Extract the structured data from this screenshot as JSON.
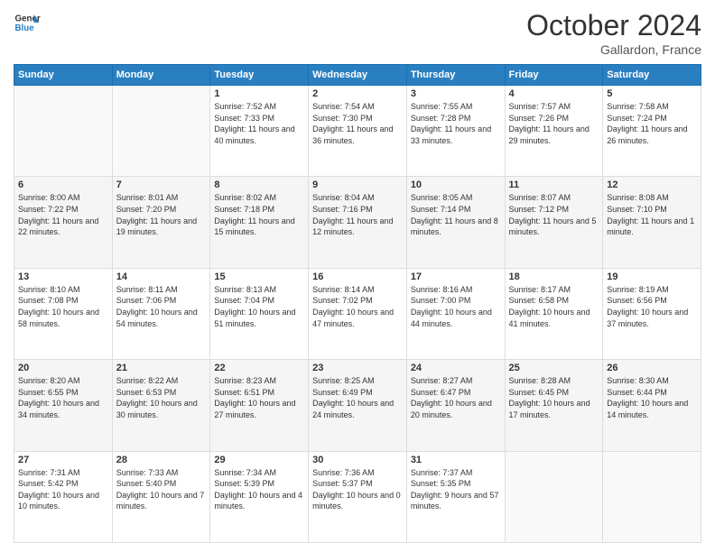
{
  "header": {
    "logo_line1": "General",
    "logo_line2": "Blue",
    "month": "October 2024",
    "location": "Gallardon, France"
  },
  "days_of_week": [
    "Sunday",
    "Monday",
    "Tuesday",
    "Wednesday",
    "Thursday",
    "Friday",
    "Saturday"
  ],
  "weeks": [
    [
      {
        "day": "",
        "sunrise": "",
        "sunset": "",
        "daylight": ""
      },
      {
        "day": "",
        "sunrise": "",
        "sunset": "",
        "daylight": ""
      },
      {
        "day": "1",
        "sunrise": "Sunrise: 7:52 AM",
        "sunset": "Sunset: 7:33 PM",
        "daylight": "Daylight: 11 hours and 40 minutes."
      },
      {
        "day": "2",
        "sunrise": "Sunrise: 7:54 AM",
        "sunset": "Sunset: 7:30 PM",
        "daylight": "Daylight: 11 hours and 36 minutes."
      },
      {
        "day": "3",
        "sunrise": "Sunrise: 7:55 AM",
        "sunset": "Sunset: 7:28 PM",
        "daylight": "Daylight: 11 hours and 33 minutes."
      },
      {
        "day": "4",
        "sunrise": "Sunrise: 7:57 AM",
        "sunset": "Sunset: 7:26 PM",
        "daylight": "Daylight: 11 hours and 29 minutes."
      },
      {
        "day": "5",
        "sunrise": "Sunrise: 7:58 AM",
        "sunset": "Sunset: 7:24 PM",
        "daylight": "Daylight: 11 hours and 26 minutes."
      }
    ],
    [
      {
        "day": "6",
        "sunrise": "Sunrise: 8:00 AM",
        "sunset": "Sunset: 7:22 PM",
        "daylight": "Daylight: 11 hours and 22 minutes."
      },
      {
        "day": "7",
        "sunrise": "Sunrise: 8:01 AM",
        "sunset": "Sunset: 7:20 PM",
        "daylight": "Daylight: 11 hours and 19 minutes."
      },
      {
        "day": "8",
        "sunrise": "Sunrise: 8:02 AM",
        "sunset": "Sunset: 7:18 PM",
        "daylight": "Daylight: 11 hours and 15 minutes."
      },
      {
        "day": "9",
        "sunrise": "Sunrise: 8:04 AM",
        "sunset": "Sunset: 7:16 PM",
        "daylight": "Daylight: 11 hours and 12 minutes."
      },
      {
        "day": "10",
        "sunrise": "Sunrise: 8:05 AM",
        "sunset": "Sunset: 7:14 PM",
        "daylight": "Daylight: 11 hours and 8 minutes."
      },
      {
        "day": "11",
        "sunrise": "Sunrise: 8:07 AM",
        "sunset": "Sunset: 7:12 PM",
        "daylight": "Daylight: 11 hours and 5 minutes."
      },
      {
        "day": "12",
        "sunrise": "Sunrise: 8:08 AM",
        "sunset": "Sunset: 7:10 PM",
        "daylight": "Daylight: 11 hours and 1 minute."
      }
    ],
    [
      {
        "day": "13",
        "sunrise": "Sunrise: 8:10 AM",
        "sunset": "Sunset: 7:08 PM",
        "daylight": "Daylight: 10 hours and 58 minutes."
      },
      {
        "day": "14",
        "sunrise": "Sunrise: 8:11 AM",
        "sunset": "Sunset: 7:06 PM",
        "daylight": "Daylight: 10 hours and 54 minutes."
      },
      {
        "day": "15",
        "sunrise": "Sunrise: 8:13 AM",
        "sunset": "Sunset: 7:04 PM",
        "daylight": "Daylight: 10 hours and 51 minutes."
      },
      {
        "day": "16",
        "sunrise": "Sunrise: 8:14 AM",
        "sunset": "Sunset: 7:02 PM",
        "daylight": "Daylight: 10 hours and 47 minutes."
      },
      {
        "day": "17",
        "sunrise": "Sunrise: 8:16 AM",
        "sunset": "Sunset: 7:00 PM",
        "daylight": "Daylight: 10 hours and 44 minutes."
      },
      {
        "day": "18",
        "sunrise": "Sunrise: 8:17 AM",
        "sunset": "Sunset: 6:58 PM",
        "daylight": "Daylight: 10 hours and 41 minutes."
      },
      {
        "day": "19",
        "sunrise": "Sunrise: 8:19 AM",
        "sunset": "Sunset: 6:56 PM",
        "daylight": "Daylight: 10 hours and 37 minutes."
      }
    ],
    [
      {
        "day": "20",
        "sunrise": "Sunrise: 8:20 AM",
        "sunset": "Sunset: 6:55 PM",
        "daylight": "Daylight: 10 hours and 34 minutes."
      },
      {
        "day": "21",
        "sunrise": "Sunrise: 8:22 AM",
        "sunset": "Sunset: 6:53 PM",
        "daylight": "Daylight: 10 hours and 30 minutes."
      },
      {
        "day": "22",
        "sunrise": "Sunrise: 8:23 AM",
        "sunset": "Sunset: 6:51 PM",
        "daylight": "Daylight: 10 hours and 27 minutes."
      },
      {
        "day": "23",
        "sunrise": "Sunrise: 8:25 AM",
        "sunset": "Sunset: 6:49 PM",
        "daylight": "Daylight: 10 hours and 24 minutes."
      },
      {
        "day": "24",
        "sunrise": "Sunrise: 8:27 AM",
        "sunset": "Sunset: 6:47 PM",
        "daylight": "Daylight: 10 hours and 20 minutes."
      },
      {
        "day": "25",
        "sunrise": "Sunrise: 8:28 AM",
        "sunset": "Sunset: 6:45 PM",
        "daylight": "Daylight: 10 hours and 17 minutes."
      },
      {
        "day": "26",
        "sunrise": "Sunrise: 8:30 AM",
        "sunset": "Sunset: 6:44 PM",
        "daylight": "Daylight: 10 hours and 14 minutes."
      }
    ],
    [
      {
        "day": "27",
        "sunrise": "Sunrise: 7:31 AM",
        "sunset": "Sunset: 5:42 PM",
        "daylight": "Daylight: 10 hours and 10 minutes."
      },
      {
        "day": "28",
        "sunrise": "Sunrise: 7:33 AM",
        "sunset": "Sunset: 5:40 PM",
        "daylight": "Daylight: 10 hours and 7 minutes."
      },
      {
        "day": "29",
        "sunrise": "Sunrise: 7:34 AM",
        "sunset": "Sunset: 5:39 PM",
        "daylight": "Daylight: 10 hours and 4 minutes."
      },
      {
        "day": "30",
        "sunrise": "Sunrise: 7:36 AM",
        "sunset": "Sunset: 5:37 PM",
        "daylight": "Daylight: 10 hours and 0 minutes."
      },
      {
        "day": "31",
        "sunrise": "Sunrise: 7:37 AM",
        "sunset": "Sunset: 5:35 PM",
        "daylight": "Daylight: 9 hours and 57 minutes."
      },
      {
        "day": "",
        "sunrise": "",
        "sunset": "",
        "daylight": ""
      },
      {
        "day": "",
        "sunrise": "",
        "sunset": "",
        "daylight": ""
      }
    ]
  ]
}
